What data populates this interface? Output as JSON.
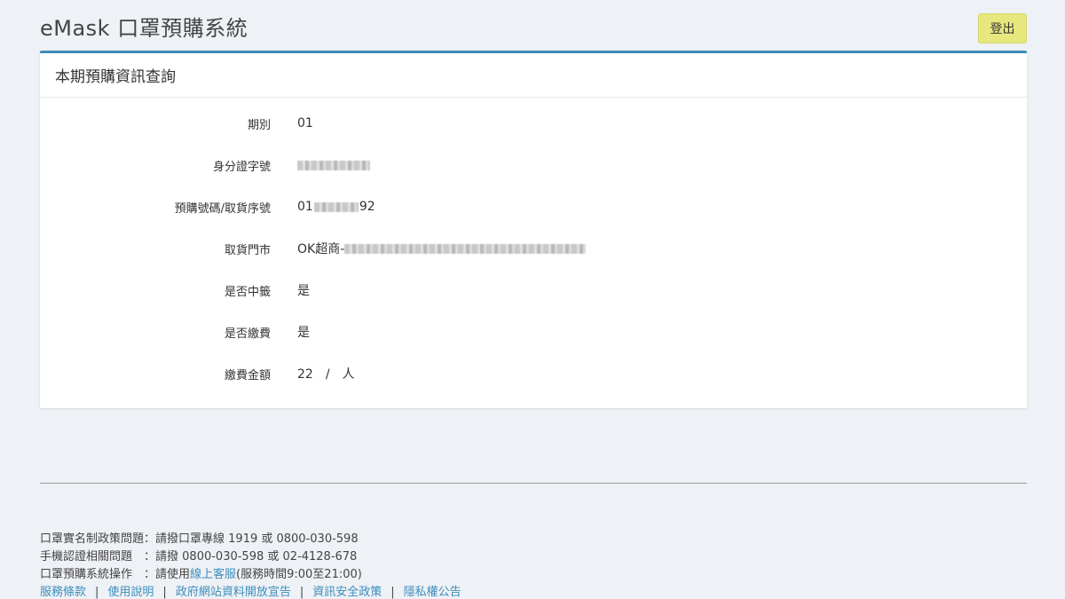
{
  "header": {
    "title": "eMask 口罩預購系統",
    "logout_label": "登出"
  },
  "panel": {
    "title": "本期預購資訊查詢",
    "rows": [
      {
        "label": "期別",
        "value": "01"
      },
      {
        "label": "身分證字號",
        "value": ""
      },
      {
        "label": "預購號碼/取貨序號",
        "value_prefix": "01",
        "value_suffix": "92"
      },
      {
        "label": "取貨門市",
        "value_prefix": "OK超商-"
      },
      {
        "label": "是否中籤",
        "value": "是"
      },
      {
        "label": "是否繳費",
        "value": "是"
      },
      {
        "label": "繳費金額",
        "value": "22　/　人"
      }
    ]
  },
  "footer": {
    "lines": [
      {
        "key": "口罩實名制政策問題：",
        "text": "請撥口罩專線 1919 或 0800-030-598"
      },
      {
        "key": "手機認證相關問題　：",
        "text": "請撥 0800-030-598 或 02-4128-678"
      },
      {
        "key": "口罩預購系統操作　：",
        "text_before": "請使用",
        "link": "線上客服",
        "text_after": "(服務時間9:00至21:00)"
      }
    ],
    "links": [
      "服務條款",
      "使用說明",
      "政府網站資料開放宣告",
      "資訊安全政策",
      "隱私權公告"
    ],
    "separator": "|"
  },
  "colors": {
    "accent": "#3c8dbc",
    "logout_bg": "#e6e77d",
    "background": "#eef1f5"
  }
}
